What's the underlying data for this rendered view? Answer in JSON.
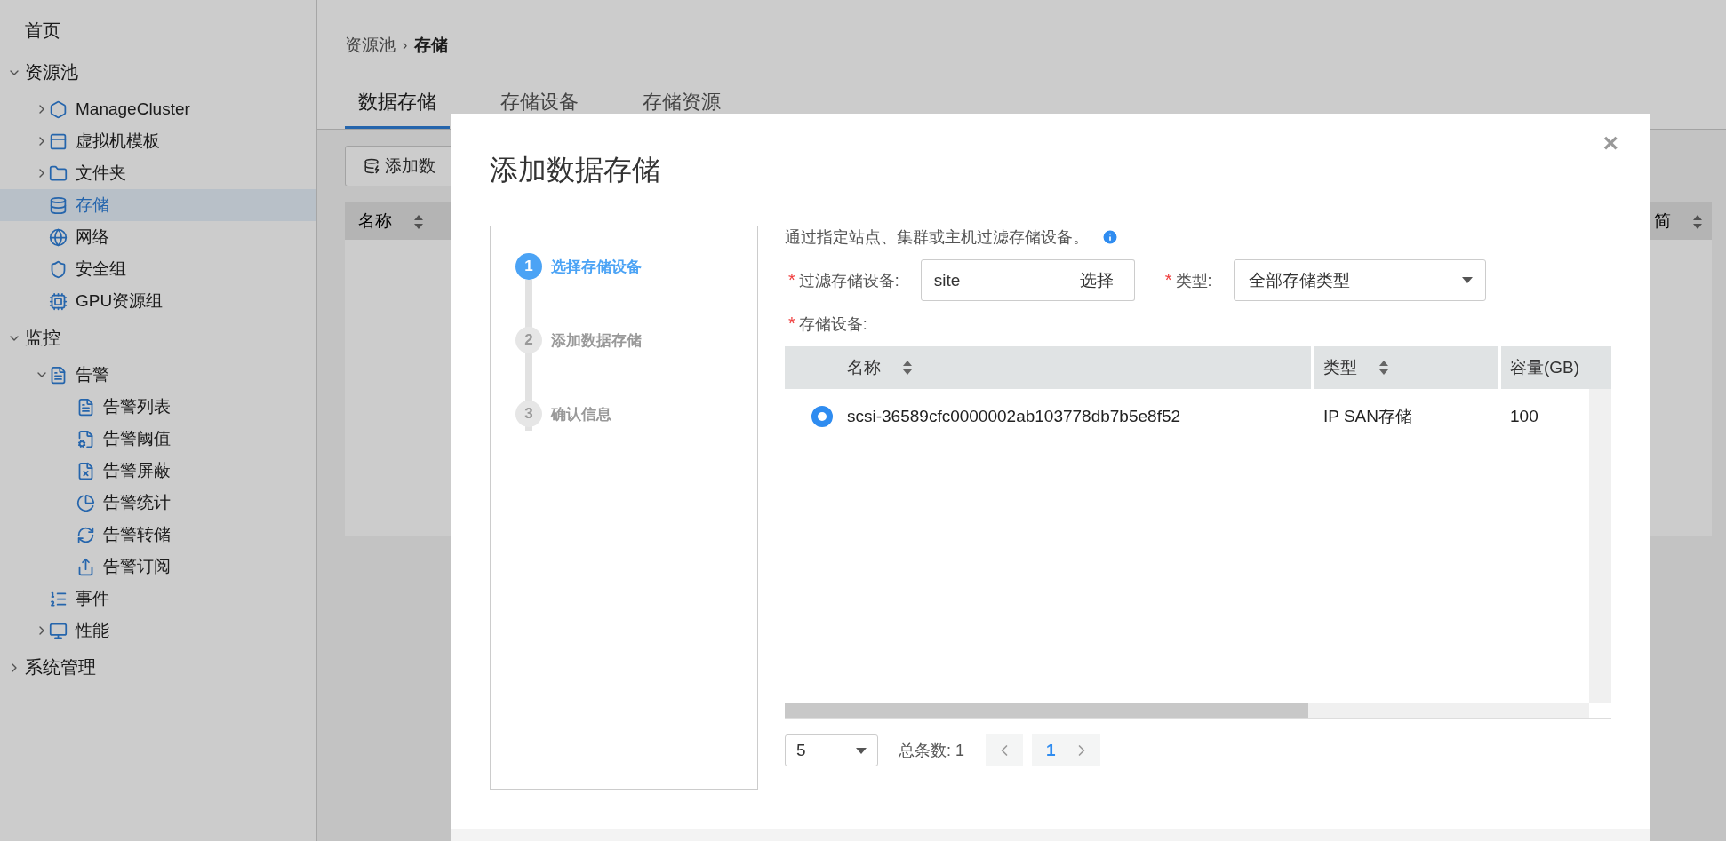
{
  "sidebar": {
    "items": [
      {
        "label": "首页",
        "kind": "leaf",
        "selected": false
      },
      {
        "label": "资源池",
        "kind": "folder",
        "expanded": true,
        "selected": false,
        "children": [
          {
            "label": "ManageCluster",
            "kind": "folder",
            "expanded": false,
            "selected": false
          },
          {
            "label": "虚拟机模板",
            "kind": "folder",
            "expanded": false,
            "selected": false
          },
          {
            "label": "文件夹",
            "kind": "folder",
            "expanded": false,
            "selected": false
          },
          {
            "label": "存储",
            "kind": "leaf",
            "selected": true
          },
          {
            "label": "网络",
            "kind": "leaf",
            "selected": false
          },
          {
            "label": "安全组",
            "kind": "leaf",
            "selected": false
          },
          {
            "label": "GPU资源组",
            "kind": "leaf",
            "selected": false
          }
        ]
      },
      {
        "label": "监控",
        "kind": "folder",
        "expanded": true,
        "selected": false,
        "children": [
          {
            "label": "告警",
            "kind": "folder",
            "expanded": true,
            "selected": false,
            "children": [
              {
                "label": "告警列表",
                "kind": "leaf",
                "selected": false
              },
              {
                "label": "告警阈值",
                "kind": "leaf",
                "selected": false
              },
              {
                "label": "告警屏蔽",
                "kind": "leaf",
                "selected": false
              },
              {
                "label": "告警统计",
                "kind": "leaf",
                "selected": false
              },
              {
                "label": "告警转储",
                "kind": "leaf",
                "selected": false
              },
              {
                "label": "告警订阅",
                "kind": "leaf",
                "selected": false
              }
            ]
          },
          {
            "label": "事件",
            "kind": "leaf",
            "selected": false
          },
          {
            "label": "性能",
            "kind": "folder",
            "expanded": false,
            "selected": false
          }
        ]
      },
      {
        "label": "系统管理",
        "kind": "folder",
        "expanded": false,
        "selected": false
      }
    ]
  },
  "breadcrumb": {
    "parent": "资源池",
    "separator": "›",
    "current": "存储"
  },
  "tabs": [
    {
      "label": "数据存储",
      "selected": true
    },
    {
      "label": "存储设备",
      "selected": false
    },
    {
      "label": "存储资源",
      "selected": false
    }
  ],
  "toolbar": {
    "add_button": "添加数"
  },
  "table": {
    "columns": [
      "名称",
      "简"
    ]
  },
  "dialog": {
    "title": "添加数据存储",
    "close": "×",
    "steps": [
      {
        "number": "1",
        "label": "选择存储设备",
        "selected": true
      },
      {
        "number": "2",
        "label": "添加数据存储",
        "selected": false
      },
      {
        "number": "3",
        "label": "确认信息",
        "selected": false
      }
    ],
    "description": "通过指定站点、集群或主机过滤存储设备。",
    "filter": {
      "required_mark": "*",
      "label": "过滤存储设备:",
      "value": "site",
      "button": "选择"
    },
    "type": {
      "required_mark": "*",
      "label": "类型:",
      "value": "全部存储类型"
    },
    "devices": {
      "required_mark": "*",
      "label": "存储设备:"
    },
    "device_table": {
      "columns": [
        "名称",
        "类型",
        "容量(GB)"
      ],
      "rows": [
        {
          "selected": true,
          "cells": [
            "scsi-36589cfc0000002ab103778db7b5e8f52",
            "IP SAN存储",
            "100"
          ]
        }
      ]
    },
    "pagination": {
      "page_size": "5",
      "total": "总条数: 1",
      "pages": [
        {
          "label": "1",
          "selected": true
        }
      ]
    }
  }
}
